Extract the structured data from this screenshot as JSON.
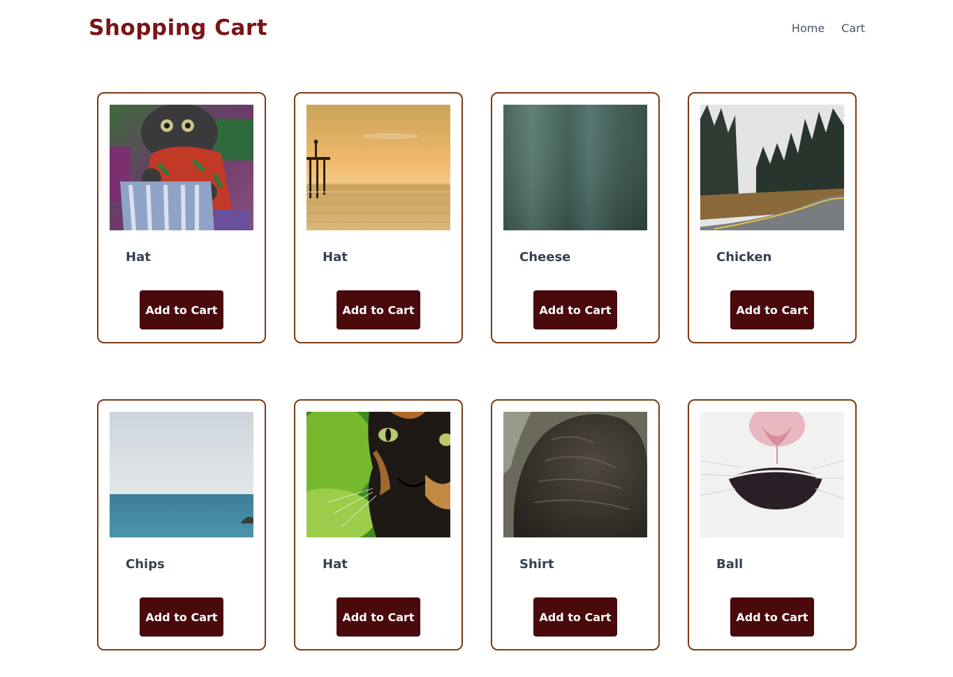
{
  "header": {
    "title": "Shopping Cart",
    "nav": [
      {
        "label": "Home"
      },
      {
        "label": "Cart"
      }
    ]
  },
  "products": [
    {
      "name": "Hat",
      "button_label": "Add to Cart",
      "image": "painted-cat-photo"
    },
    {
      "name": "Hat",
      "button_label": "Add to Cart",
      "image": "sunset-pier-photo"
    },
    {
      "name": "Cheese",
      "button_label": "Add to Cart",
      "image": "blurred-green-photo"
    },
    {
      "name": "Chicken",
      "button_label": "Add to Cart",
      "image": "forest-road-photo"
    },
    {
      "name": "Chips",
      "button_label": "Add to Cart",
      "image": "sea-horizon-photo"
    },
    {
      "name": "Hat",
      "button_label": "Add to Cart",
      "image": "tortoiseshell-cat-photo"
    },
    {
      "name": "Shirt",
      "button_label": "Add to Cart",
      "image": "cat-fur-photo"
    },
    {
      "name": "Ball",
      "button_label": "Add to Cart",
      "image": "cat-nose-photo"
    }
  ],
  "colors": {
    "brand": "#7b1416",
    "button": "#4a090b",
    "card_border": "#7a3a12",
    "nav_text": "#4a5563"
  }
}
